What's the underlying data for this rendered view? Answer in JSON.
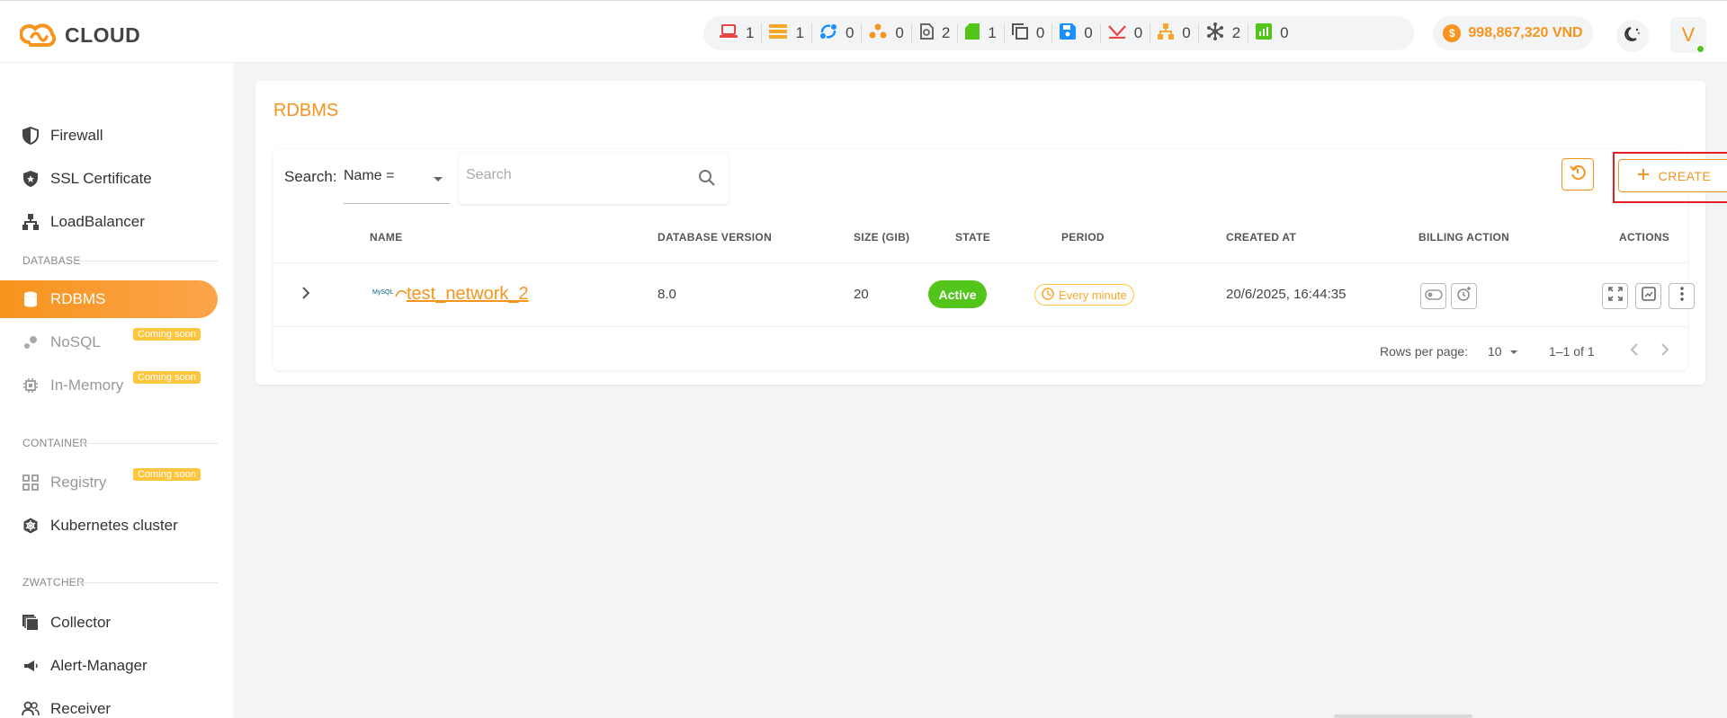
{
  "brand": {
    "name": "CLOUD"
  },
  "header": {
    "resource_counts": [
      {
        "icon": "laptop-icon",
        "value": "1",
        "color": "#e84545"
      },
      {
        "icon": "server-stack-icon",
        "value": "1",
        "color": "#f7a829"
      },
      {
        "icon": "network-sync-icon",
        "value": "0",
        "color": "#1890ff"
      },
      {
        "icon": "cluster-dots-icon",
        "value": "0",
        "color": "#f7941d"
      },
      {
        "icon": "snapshot-icon",
        "value": "2",
        "color": "#666666"
      },
      {
        "icon": "sd-card-icon",
        "value": "1",
        "color": "#52c41a"
      },
      {
        "icon": "copy-icon",
        "value": "0",
        "color": "#555555"
      },
      {
        "icon": "floppy-icon",
        "value": "0",
        "color": "#1890ff"
      },
      {
        "icon": "route-icon",
        "value": "0",
        "color": "#e84545"
      },
      {
        "icon": "hierarchy-icon",
        "value": "0",
        "color": "#f7a829"
      },
      {
        "icon": "hub-icon",
        "value": "2",
        "color": "#555555"
      },
      {
        "icon": "bar-chart-icon",
        "value": "0",
        "color": "#52c41a"
      }
    ],
    "balance": "998,867,320 VND",
    "avatar_letter": "V"
  },
  "sidebar": {
    "items_top": [
      {
        "label": "Firewall",
        "icon": "shield-half-icon"
      },
      {
        "label": "SSL Certificate",
        "icon": "shield-star-icon"
      },
      {
        "label": "LoadBalancer",
        "icon": "sitemap-icon"
      }
    ],
    "sections": [
      {
        "title": "DATABASE",
        "items": [
          {
            "label": "RDBMS",
            "icon": "database-icon",
            "active": true
          },
          {
            "label": "NoSQL",
            "icon": "nosql-icon",
            "badge": "Coming soon"
          },
          {
            "label": "In-Memory",
            "icon": "chip-icon",
            "badge": "Coming soon"
          }
        ]
      },
      {
        "title": "CONTAINER",
        "items": [
          {
            "label": "Registry",
            "icon": "grid-icon",
            "badge": "Coming soon"
          },
          {
            "label": "Kubernetes cluster",
            "icon": "helm-icon"
          }
        ]
      },
      {
        "title": "ZWATCHER",
        "items": [
          {
            "label": "Collector",
            "icon": "stack-icon"
          },
          {
            "label": "Alert-Manager",
            "icon": "megaphone-icon"
          },
          {
            "label": "Receiver",
            "icon": "users-icon"
          }
        ]
      }
    ]
  },
  "main": {
    "title": "RDBMS",
    "search": {
      "label": "Search:",
      "field_value": "Name =",
      "placeholder": "Search"
    },
    "create_label": "CREATE",
    "table": {
      "columns": [
        "NAME",
        "DATABASE VERSION",
        "SIZE (GIB)",
        "STATE",
        "PERIOD",
        "CREATED AT",
        "BILLING ACTION",
        "ACTIONS"
      ],
      "rows": [
        {
          "logo_text": "MySQL",
          "name": "test_network_2",
          "version": "8.0",
          "size": "20",
          "state": "Active",
          "period": "Every minute",
          "created_at": "20/6/2025, 16:44:35"
        }
      ]
    },
    "pagination": {
      "rows_per_page_label": "Rows per page:",
      "rows_per_page": "10",
      "range": "1–1 of 1"
    }
  }
}
